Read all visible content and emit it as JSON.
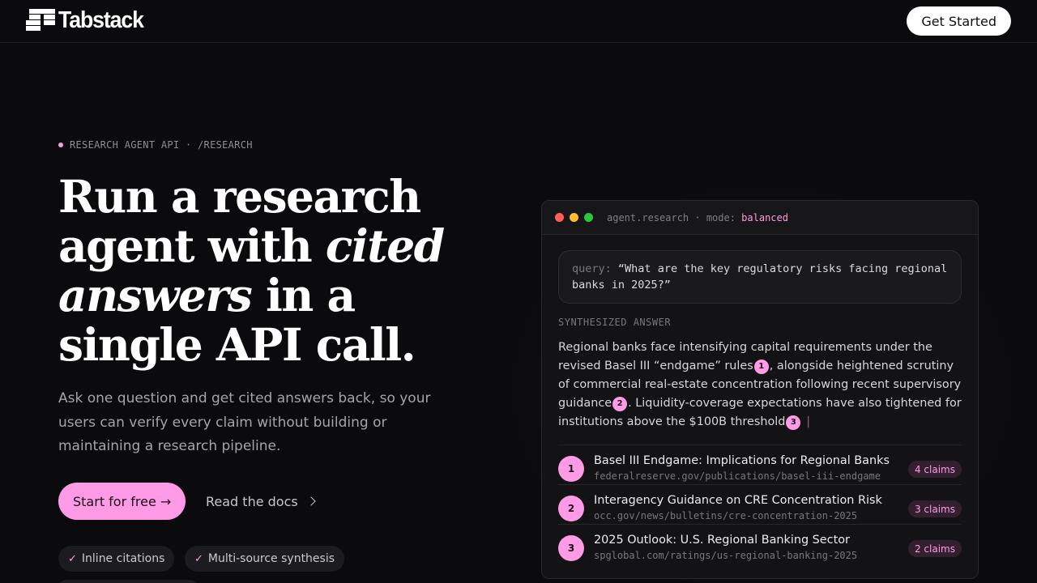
{
  "header": {
    "brand": "Tabstack",
    "cta": "Get Started"
  },
  "hero": {
    "eyebrow": "RESEARCH AGENT API · /RESEARCH",
    "headline": {
      "part1": "Run a research agent with ",
      "italic1": "cited answers",
      "part2": " in a single API call."
    },
    "subtext": "Ask one question and get cited answers back, so your users can verify every claim without building or maintaining a research pipeline.",
    "primary_cta": "Start for free →",
    "secondary_cta": "Read the docs",
    "features": [
      "Inline citations",
      "Multi-source synthesis"
    ]
  },
  "card": {
    "title_prefix": "agent.research · mode: ",
    "mode": "balanced",
    "query_key": "query:",
    "query_text": "“What are the key regulatory risks facing regional banks in 2025?”",
    "section_label": "SYNTHESIZED ANSWER",
    "answer": {
      "seg1": "Regional banks face intensifying capital requirements under the revised Basel III “endgame” rules",
      "seg2": ", alongside heightened scrutiny of commercial real-estate concentration following recent supervisory guidance",
      "seg3": ". Liquidity-coverage expectations have also tightened for institutions above the $100B threshold",
      "cite1": "1",
      "cite2": "2",
      "cite3": "3",
      "caret": "|"
    },
    "sources": [
      {
        "num": "1",
        "title": "Basel III Endgame: Implications for Regional Banks",
        "url": "federalreserve.gov/publications/basel-iii-endgame",
        "claims": "4 claims"
      },
      {
        "num": "2",
        "title": "Interagency Guidance on CRE Concentration Risk",
        "url": "occ.gov/news/bulletins/cre-concentration-2025",
        "claims": "3 claims"
      },
      {
        "num": "3",
        "title": "2025 Outlook: U.S. Regional Banking Sector",
        "url": "spglobal.com/ratings/us-regional-banking-2025",
        "claims": "2 claims"
      }
    ]
  },
  "colors": {
    "accent": "#ff9be6",
    "background": "#0b0b0d",
    "traffic_red": "#ff5f57",
    "traffic_yellow": "#febc2e",
    "traffic_green": "#28c840"
  }
}
